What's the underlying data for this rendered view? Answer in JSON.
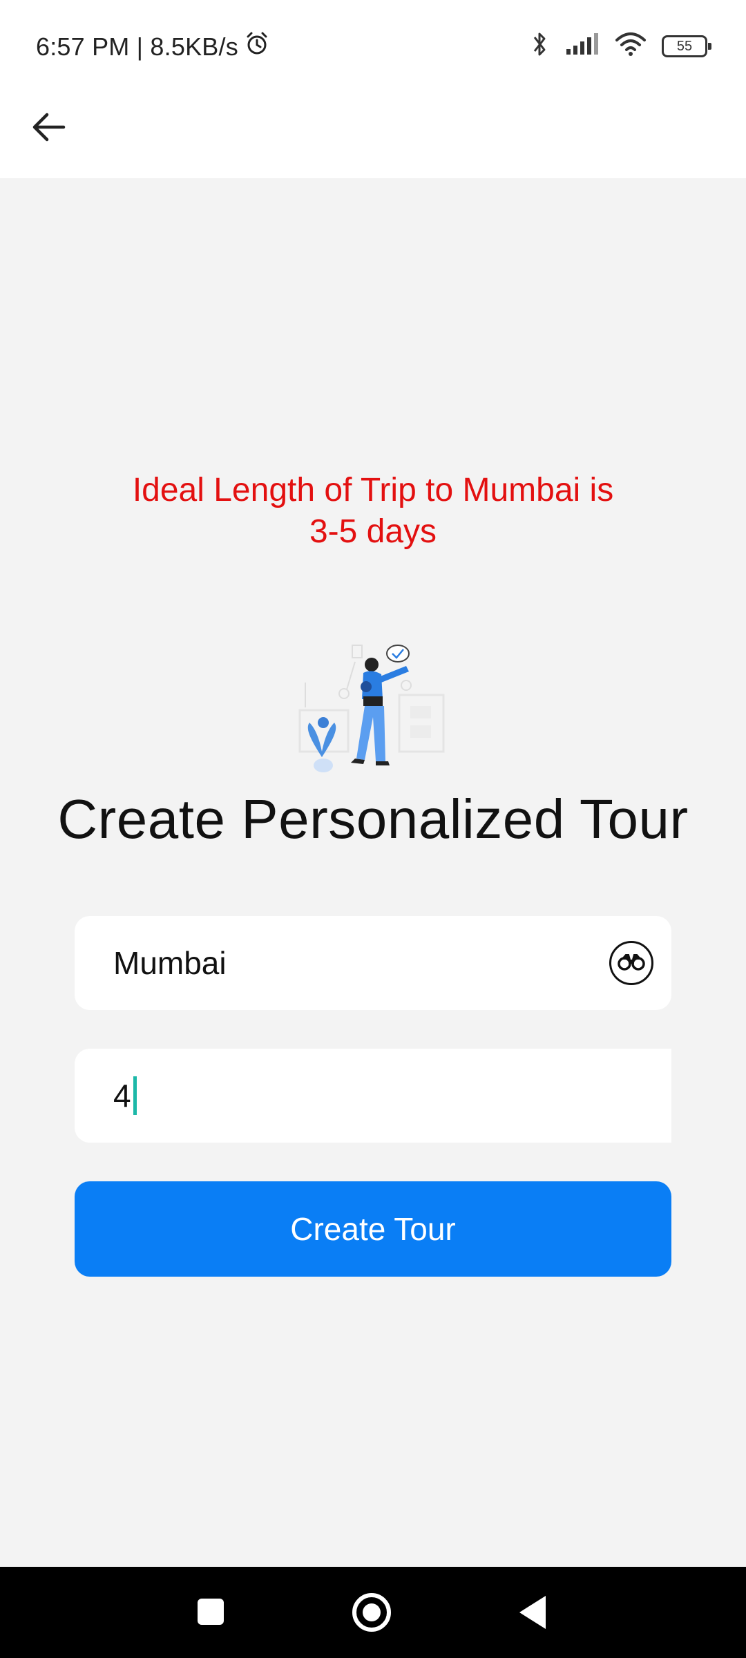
{
  "status_bar": {
    "time_speed": "6:57 PM | 8.5KB/s",
    "battery": "55",
    "icons": [
      "alarm-icon",
      "bluetooth-icon",
      "signal-icon",
      "wifi-icon",
      "battery-icon"
    ]
  },
  "app_bar": {
    "back_icon": "arrow-left-icon"
  },
  "hint": {
    "line1": "Ideal Length of Trip to Mumbai is",
    "line2": "3-5 days"
  },
  "title": "Create Personalized Tour",
  "form": {
    "city_value": "Mumbai",
    "city_icon": "binoculars-icon",
    "days_value": "4",
    "create_label": "Create Tour"
  },
  "colors": {
    "hint": "#e31010",
    "primary": "#0a7ef5",
    "background": "#f3f3f3",
    "cursor": "#1cb8a8"
  }
}
